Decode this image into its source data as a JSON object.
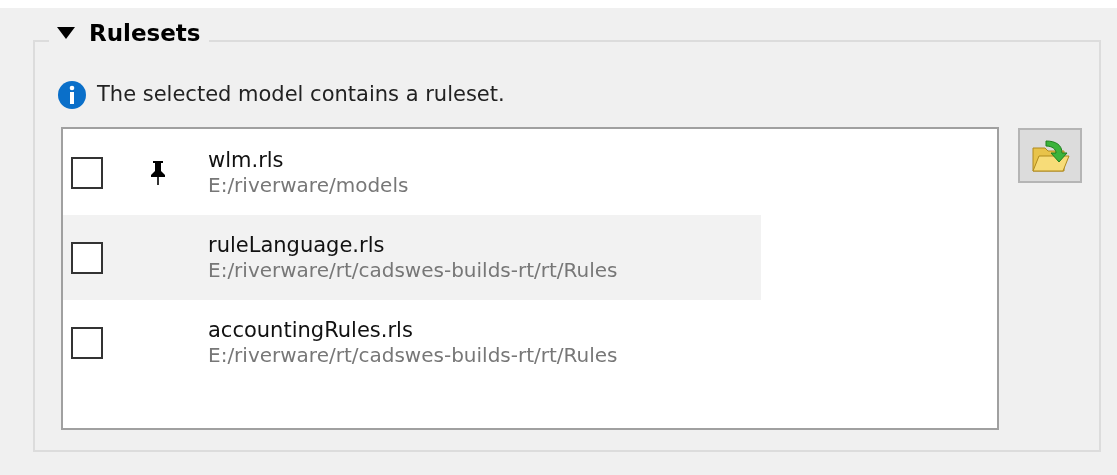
{
  "section": {
    "title": "Rulesets",
    "expanded": true
  },
  "info": {
    "text": "The selected model contains a ruleset."
  },
  "rulesets": [
    {
      "name": "wlm.rls",
      "path": "E:/riverware/models",
      "checked": false,
      "pinned": true,
      "highlighted": false
    },
    {
      "name": "ruleLanguage.rls",
      "path": "E:/riverware/rt/cadswes-builds-rt/rt/Rules",
      "checked": false,
      "pinned": false,
      "highlighted": true
    },
    {
      "name": "accountingRules.rls",
      "path": "E:/riverware/rt/cadswes-builds-rt/rt/Rules",
      "checked": false,
      "pinned": false,
      "highlighted": false
    }
  ]
}
